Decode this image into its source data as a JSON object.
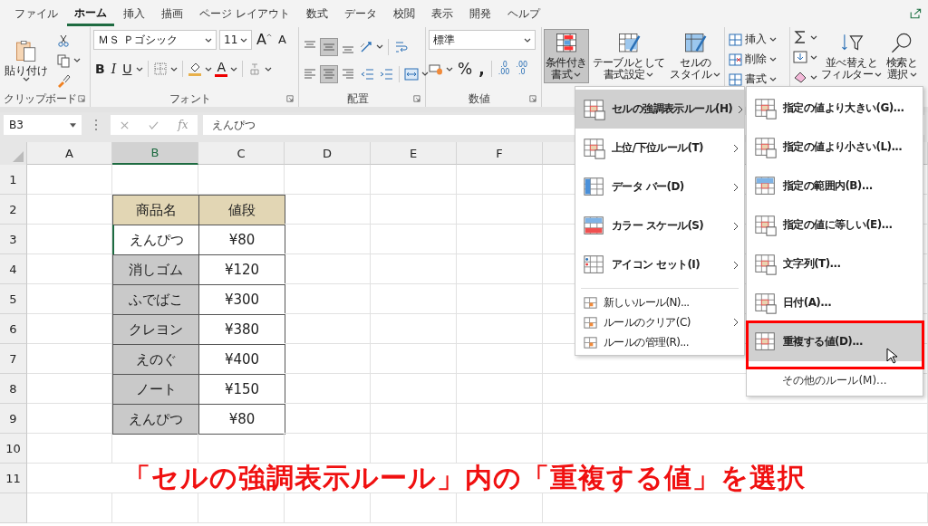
{
  "tabs": [
    {
      "label": "ファイル",
      "selected": false
    },
    {
      "label": "ホーム",
      "selected": true
    },
    {
      "label": "挿入",
      "selected": false
    },
    {
      "label": "描画",
      "selected": false
    },
    {
      "label": "ページ レイアウト",
      "selected": false
    },
    {
      "label": "数式",
      "selected": false
    },
    {
      "label": "データ",
      "selected": false
    },
    {
      "label": "校閲",
      "selected": false
    },
    {
      "label": "表示",
      "selected": false
    },
    {
      "label": "開発",
      "selected": false
    },
    {
      "label": "ヘルプ",
      "selected": false
    }
  ],
  "clipboard": {
    "paste": "貼り付け",
    "group": "クリップボード"
  },
  "font": {
    "name": "ＭＳ Ｐゴシック",
    "size": "11",
    "grow": "A",
    "shrink": "A",
    "styles": [
      "B",
      "I",
      "U"
    ],
    "color_button": "A",
    "group": "フォント"
  },
  "alignment": {
    "vertical": [
      {
        "selected": false
      },
      {
        "selected": true
      },
      {
        "selected": false
      }
    ],
    "horizontal": [
      {
        "selected": false
      },
      {
        "selected": true
      },
      {
        "selected": false
      }
    ],
    "group": "配置"
  },
  "number": {
    "format": "標準",
    "symbols": [
      "%",
      ","
    ],
    "decimals": [
      {
        "top": ".0",
        "bottom": ".00"
      },
      {
        "top": ".00",
        "bottom": ".0"
      }
    ],
    "group": "数値"
  },
  "styles": [
    {
      "label": [
        "条件付き",
        "書式"
      ],
      "selected": true
    },
    {
      "label": [
        "テーブルとして",
        "書式設定"
      ],
      "selected": false
    },
    {
      "label": [
        "セルの",
        "スタイル"
      ],
      "selected": false
    }
  ],
  "cells": [
    "挿入",
    "削除",
    "書式"
  ],
  "editing": {
    "sort": [
      "並べ替えと",
      "フィルター"
    ],
    "find": [
      "検索と",
      "選択"
    ]
  },
  "formula_bar": {
    "name_box": "B3",
    "fx": "fx",
    "value": "えんぴつ"
  },
  "sheet": {
    "columns": [
      {
        "label": "A",
        "selected": false
      },
      {
        "label": "B",
        "selected": true
      },
      {
        "label": "C",
        "selected": false
      },
      {
        "label": "D",
        "selected": false
      },
      {
        "label": "E",
        "selected": false
      },
      {
        "label": "F",
        "selected": false
      }
    ],
    "rows": [
      {
        "number": "1"
      },
      {
        "number": "2",
        "cells": [
          {
            "text": "商品名",
            "kind": "header"
          },
          {
            "text": "値段",
            "kind": "header"
          }
        ]
      },
      {
        "number": "3",
        "cells": [
          {
            "text": "えんぴつ",
            "kind": "active"
          },
          {
            "text": "¥80",
            "kind": "value"
          }
        ]
      },
      {
        "number": "4",
        "cells": [
          {
            "text": "消しゴム",
            "kind": "selected"
          },
          {
            "text": "¥120",
            "kind": "value"
          }
        ]
      },
      {
        "number": "5",
        "cells": [
          {
            "text": "ふでばこ",
            "kind": "selected"
          },
          {
            "text": "¥300",
            "kind": "value"
          }
        ]
      },
      {
        "number": "6",
        "cells": [
          {
            "text": "クレヨン",
            "kind": "selected"
          },
          {
            "text": "¥380",
            "kind": "value"
          }
        ]
      },
      {
        "number": "7",
        "cells": [
          {
            "text": "えのぐ",
            "kind": "selected"
          },
          {
            "text": "¥400",
            "kind": "value"
          }
        ]
      },
      {
        "number": "8",
        "cells": [
          {
            "text": "ノート",
            "kind": "selected"
          },
          {
            "text": "¥150",
            "kind": "value"
          }
        ]
      },
      {
        "number": "9",
        "cells": [
          {
            "text": "えんぴつ",
            "kind": "selected"
          },
          {
            "text": "¥80",
            "kind": "value"
          }
        ]
      },
      {
        "number": "10"
      },
      {
        "number": "11",
        "caption": "「セルの強調表示ルール」内の「重複する値」を選択"
      }
    ]
  },
  "menu": {
    "items": [
      {
        "label": "セルの強調表示ルール(H)",
        "kind": "rule",
        "submenu": true,
        "selected": true
      },
      {
        "label": "上位/下位ルール(T)",
        "kind": "rule",
        "submenu": true,
        "selected": false
      },
      {
        "label": "データ バー(D)",
        "kind": "rule",
        "submenu": true,
        "selected": false
      },
      {
        "label": "カラー スケール(S)",
        "kind": "rule",
        "submenu": true,
        "selected": false
      },
      {
        "label": "アイコン セット(I)",
        "kind": "rule",
        "submenu": true,
        "selected": false
      },
      {
        "label": "新しいルール(N)...",
        "kind": "command",
        "submenu": false,
        "selected": false
      },
      {
        "label": "ルールのクリア(C)",
        "kind": "command",
        "submenu": true,
        "selected": false
      },
      {
        "label": "ルールの管理(R)...",
        "kind": "command",
        "submenu": false,
        "selected": false
      }
    ]
  },
  "submenu": {
    "items": [
      {
        "label": "指定の値より大きい(G)...",
        "selected": false
      },
      {
        "label": "指定の値より小さい(L)...",
        "selected": false
      },
      {
        "label": "指定の範囲内(B)...",
        "selected": false
      },
      {
        "label": "指定の値に等しい(E)...",
        "selected": false
      },
      {
        "label": "文字列(T)...",
        "selected": false
      },
      {
        "label": "日付(A)...",
        "selected": false
      },
      {
        "label": "重複する値(D)...",
        "selected": true
      }
    ],
    "more": "その他のルール(M)..."
  }
}
